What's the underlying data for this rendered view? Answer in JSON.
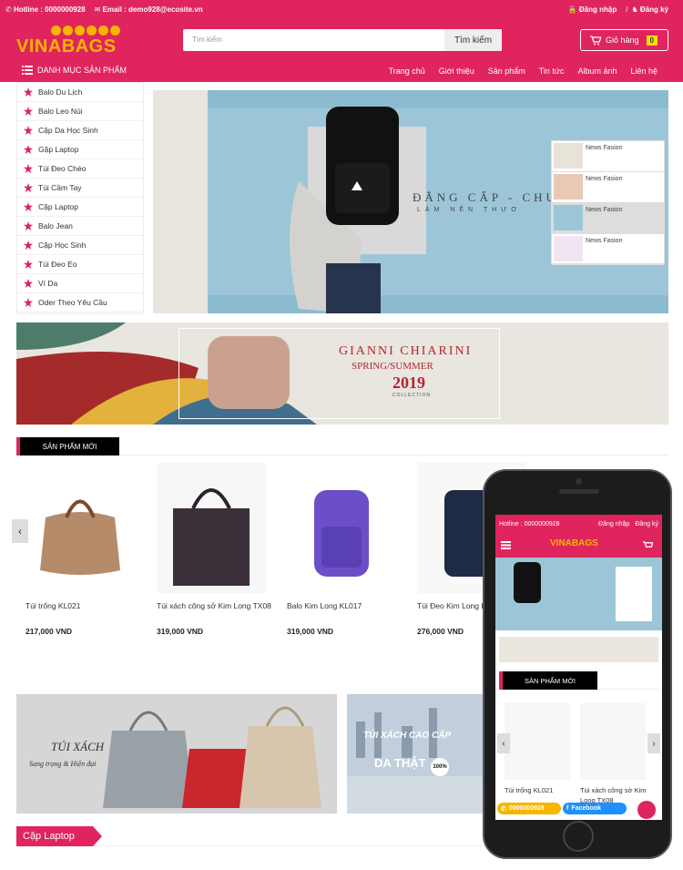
{
  "topbar": {
    "hotline": "Hotline : 0000000928",
    "email": "Email : demo928@ecosite.vn",
    "login": "Đăng nhập",
    "separator": "/",
    "register": "Đăng ký"
  },
  "header": {
    "logo": "VINABAGS",
    "search_placeholder": "Tìm kiếm",
    "search_button": "Tìm kiếm",
    "cart_label": "Giỏ hàng",
    "cart_count": "0"
  },
  "nav": {
    "category_title": "DANH MỤC SẢN PHẨM",
    "menu": [
      "Trang chủ",
      "Giới thiệu",
      "Sản phẩm",
      "Tin tức",
      "Album ảnh",
      "Liên hệ"
    ]
  },
  "sidebar": {
    "items": [
      "Balo Du Lịch",
      "Balo Leo Núi",
      "Cặp Da Học Sinh",
      "Gặp Laptop",
      "Túi Đeo Chéo",
      "Túi Cầm Tay",
      "Cặp Laptop",
      "Balo Jean",
      "Cặp Học Sinh",
      "Túi Đeo Eo",
      "Ví Da",
      "Oder Theo Yêu Cầu"
    ]
  },
  "slider": {
    "slogan": "ĐẲNG CẤP - CHU",
    "subslogan": "LÀM NÊN THƯƠ",
    "thumbs": [
      "News Fasion",
      "News Fasion",
      "News Fasion",
      "News Fasion"
    ]
  },
  "banner1": {
    "brand": "GIANNI CHIARINI",
    "season": "SPRING/SUMMER",
    "year": "2019",
    "collection": "COLLECTION"
  },
  "new_products": {
    "title": "SẢN PHẨM MỚI",
    "items": [
      {
        "name": "Túi trống KL021",
        "price": "217,000 VND"
      },
      {
        "name": "Túi xách công sở Kim Long TX08",
        "price": "319,000 VND"
      },
      {
        "name": "Balo Kim Long KL017",
        "price": "319,000 VND"
      },
      {
        "name": "Túi Đeo Kim Long K",
        "price": "276,000 VND"
      }
    ]
  },
  "banner2": {
    "title": "TÚI XÁCH",
    "subtitle": "Sang trọng  &  Hiện đại"
  },
  "banner3": {
    "title": "TÚI XÁCH CAO CẤP",
    "subtitle": "DA THẬT",
    "badge": "100%"
  },
  "category2": {
    "title": "Cặp Laptop"
  },
  "phone": {
    "hotline": "Hotline : 0000000928",
    "login": "Đăng nhập",
    "register": "Đăng ký",
    "logo": "VINABAGS",
    "section_title": "SẢN PHẨM MỚI",
    "products": [
      "Túi trống KL021",
      "Túi xách công sở Kim Long TX08"
    ],
    "hotline_button": "0000000928",
    "facebook_button": "Facebook"
  },
  "colors": {
    "brand": "#e0245e",
    "logo": "#f7b500"
  }
}
